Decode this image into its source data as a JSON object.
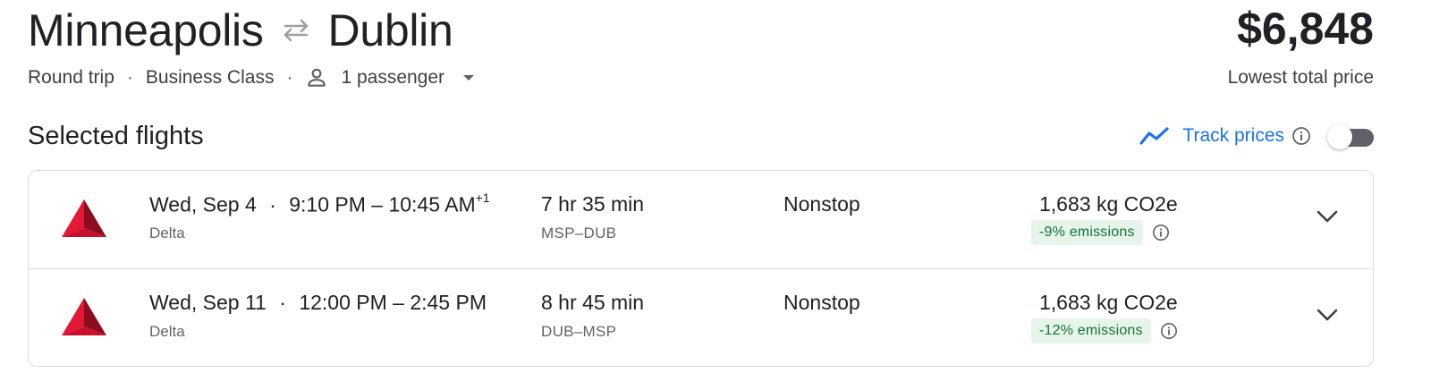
{
  "route": {
    "origin": "Minneapolis",
    "destination": "Dublin",
    "swap_icon": "swap-arrows-icon"
  },
  "trip": {
    "type": "Round trip",
    "class": "Business Class",
    "passengers": "1 passenger",
    "separator": "·"
  },
  "price": {
    "amount": "$6,848",
    "label": "Lowest total price"
  },
  "section": {
    "title": "Selected flights"
  },
  "track_prices": {
    "label": "Track prices",
    "enabled": false
  },
  "colors": {
    "accent": "#1a73e8",
    "delta_red": "#c8102e",
    "emission_bg": "#e6f4ea",
    "emission_text": "#137333"
  },
  "flights": [
    {
      "date": "Wed, Sep 4",
      "sep": "·",
      "times": "9:10 PM – 10:45 AM",
      "day_offset": "+1",
      "airline": "Delta",
      "duration": "7 hr 35 min",
      "airports": "MSP–DUB",
      "stops": "Nonstop",
      "co2": "1,683 kg CO2e",
      "emissions": "-9% emissions"
    },
    {
      "date": "Wed, Sep 11",
      "sep": "·",
      "times": "12:00 PM – 2:45 PM",
      "day_offset": "",
      "airline": "Delta",
      "duration": "8 hr 45 min",
      "airports": "DUB–MSP",
      "stops": "Nonstop",
      "co2": "1,683 kg CO2e",
      "emissions": "-12% emissions"
    }
  ]
}
